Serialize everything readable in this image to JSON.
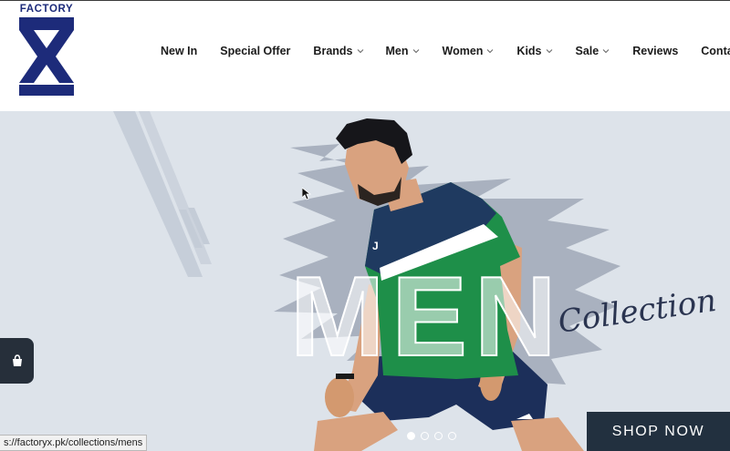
{
  "logo": {
    "text": "FACTORY",
    "brand_color": "#1d2b7a"
  },
  "nav": {
    "items": [
      {
        "label": "New In",
        "has_dropdown": false
      },
      {
        "label": "Special Offer",
        "has_dropdown": false
      },
      {
        "label": "Brands",
        "has_dropdown": true
      },
      {
        "label": "Men",
        "has_dropdown": true
      },
      {
        "label": "Women",
        "has_dropdown": true
      },
      {
        "label": "Kids",
        "has_dropdown": true
      },
      {
        "label": "Sale",
        "has_dropdown": true
      },
      {
        "label": "Reviews",
        "has_dropdown": false
      },
      {
        "label": "Contact Us",
        "has_dropdown": false
      }
    ]
  },
  "hero": {
    "big_word": "MEN",
    "script_word": "Collection",
    "cta_label": "SHOP NOW",
    "background_color": "#dde3ea",
    "slides_count": 4,
    "active_slide": 1
  },
  "status_bar": {
    "url": "s://factoryx.pk/collections/mens"
  }
}
